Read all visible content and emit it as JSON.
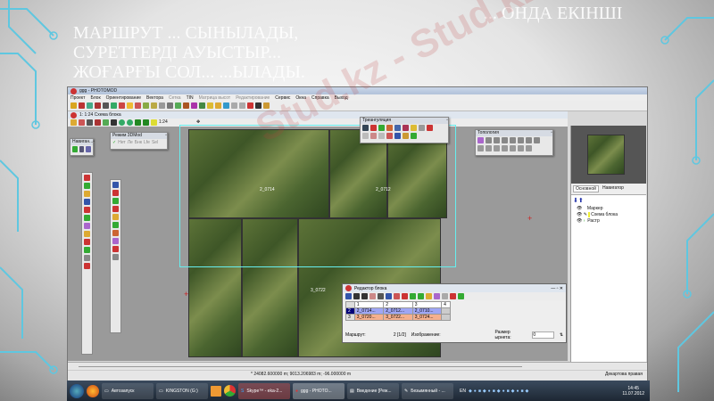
{
  "slide": {
    "title_lines": [
      "... ОНДА ЕКІНШІ",
      "МАРШРУТ ... СЫНЫЛАДЫ,",
      "СУРЕТТЕРДІ АУЫСТЫР...",
      "ЖОҒАРҒЫ СОЛ... ...ЫЛАДЫ."
    ],
    "watermark": "Stud.kz - Stud.kz"
  },
  "app": {
    "title": "ggg - PHOTOMOD",
    "menu": [
      "Проект",
      "Блок",
      "Ориентирование",
      "Вектора",
      "Сетка",
      "TIN",
      "Матрица высот",
      "Редактирование",
      "Сервис",
      "Окна",
      "Справка",
      "Выход"
    ],
    "child_title": "1: 1:24 Схема блока",
    "scale": "1:24",
    "navigator_panel": "Навиган...",
    "mode_panel": {
      "title": "Режим 3DMod",
      "buttons": [
        "Нет",
        "Ле",
        "Бнк",
        "Lfe",
        "Sel"
      ]
    },
    "triangulation_panel": "Триангуляция",
    "topology_panel": "Топология",
    "image_labels": [
      "2_0714",
      "2_0712",
      "3_0722"
    ],
    "right_tabs": [
      "Основной",
      "Навигатор"
    ],
    "layers": [
      "Маркер",
      "Схема блока",
      "Растр"
    ],
    "status_coords": "* 24082.600000 m; 9013.206983 m; -96.000000 m",
    "status_right": "Декартова правая",
    "block_editor": {
      "title": "Редактор блока",
      "columns": [
        "1",
        "2",
        "3",
        "4"
      ],
      "rows": [
        {
          "id": "2",
          "cells": [
            "2_0714...",
            "2_0712...",
            "2_0710..."
          ]
        },
        {
          "id": "3",
          "cells": [
            "3_0720...",
            "3_0722...",
            "3_0724..."
          ]
        }
      ],
      "route_label": "Маршрут:",
      "route_value": "2 [1/2]",
      "image_label": "Изображение:",
      "marker_label": "Размер ырнета:",
      "marker_value": "0"
    }
  },
  "taskbar": {
    "items": [
      "Автозапуск",
      "KINGSTON (G:)",
      "",
      "",
      "Skype™ - eka-2...",
      "ggg - PHOTO...",
      "Введение [Реж...",
      "Безымянный - ..."
    ],
    "lang": "EN",
    "time": "14:45",
    "date": "11.07.2012"
  }
}
